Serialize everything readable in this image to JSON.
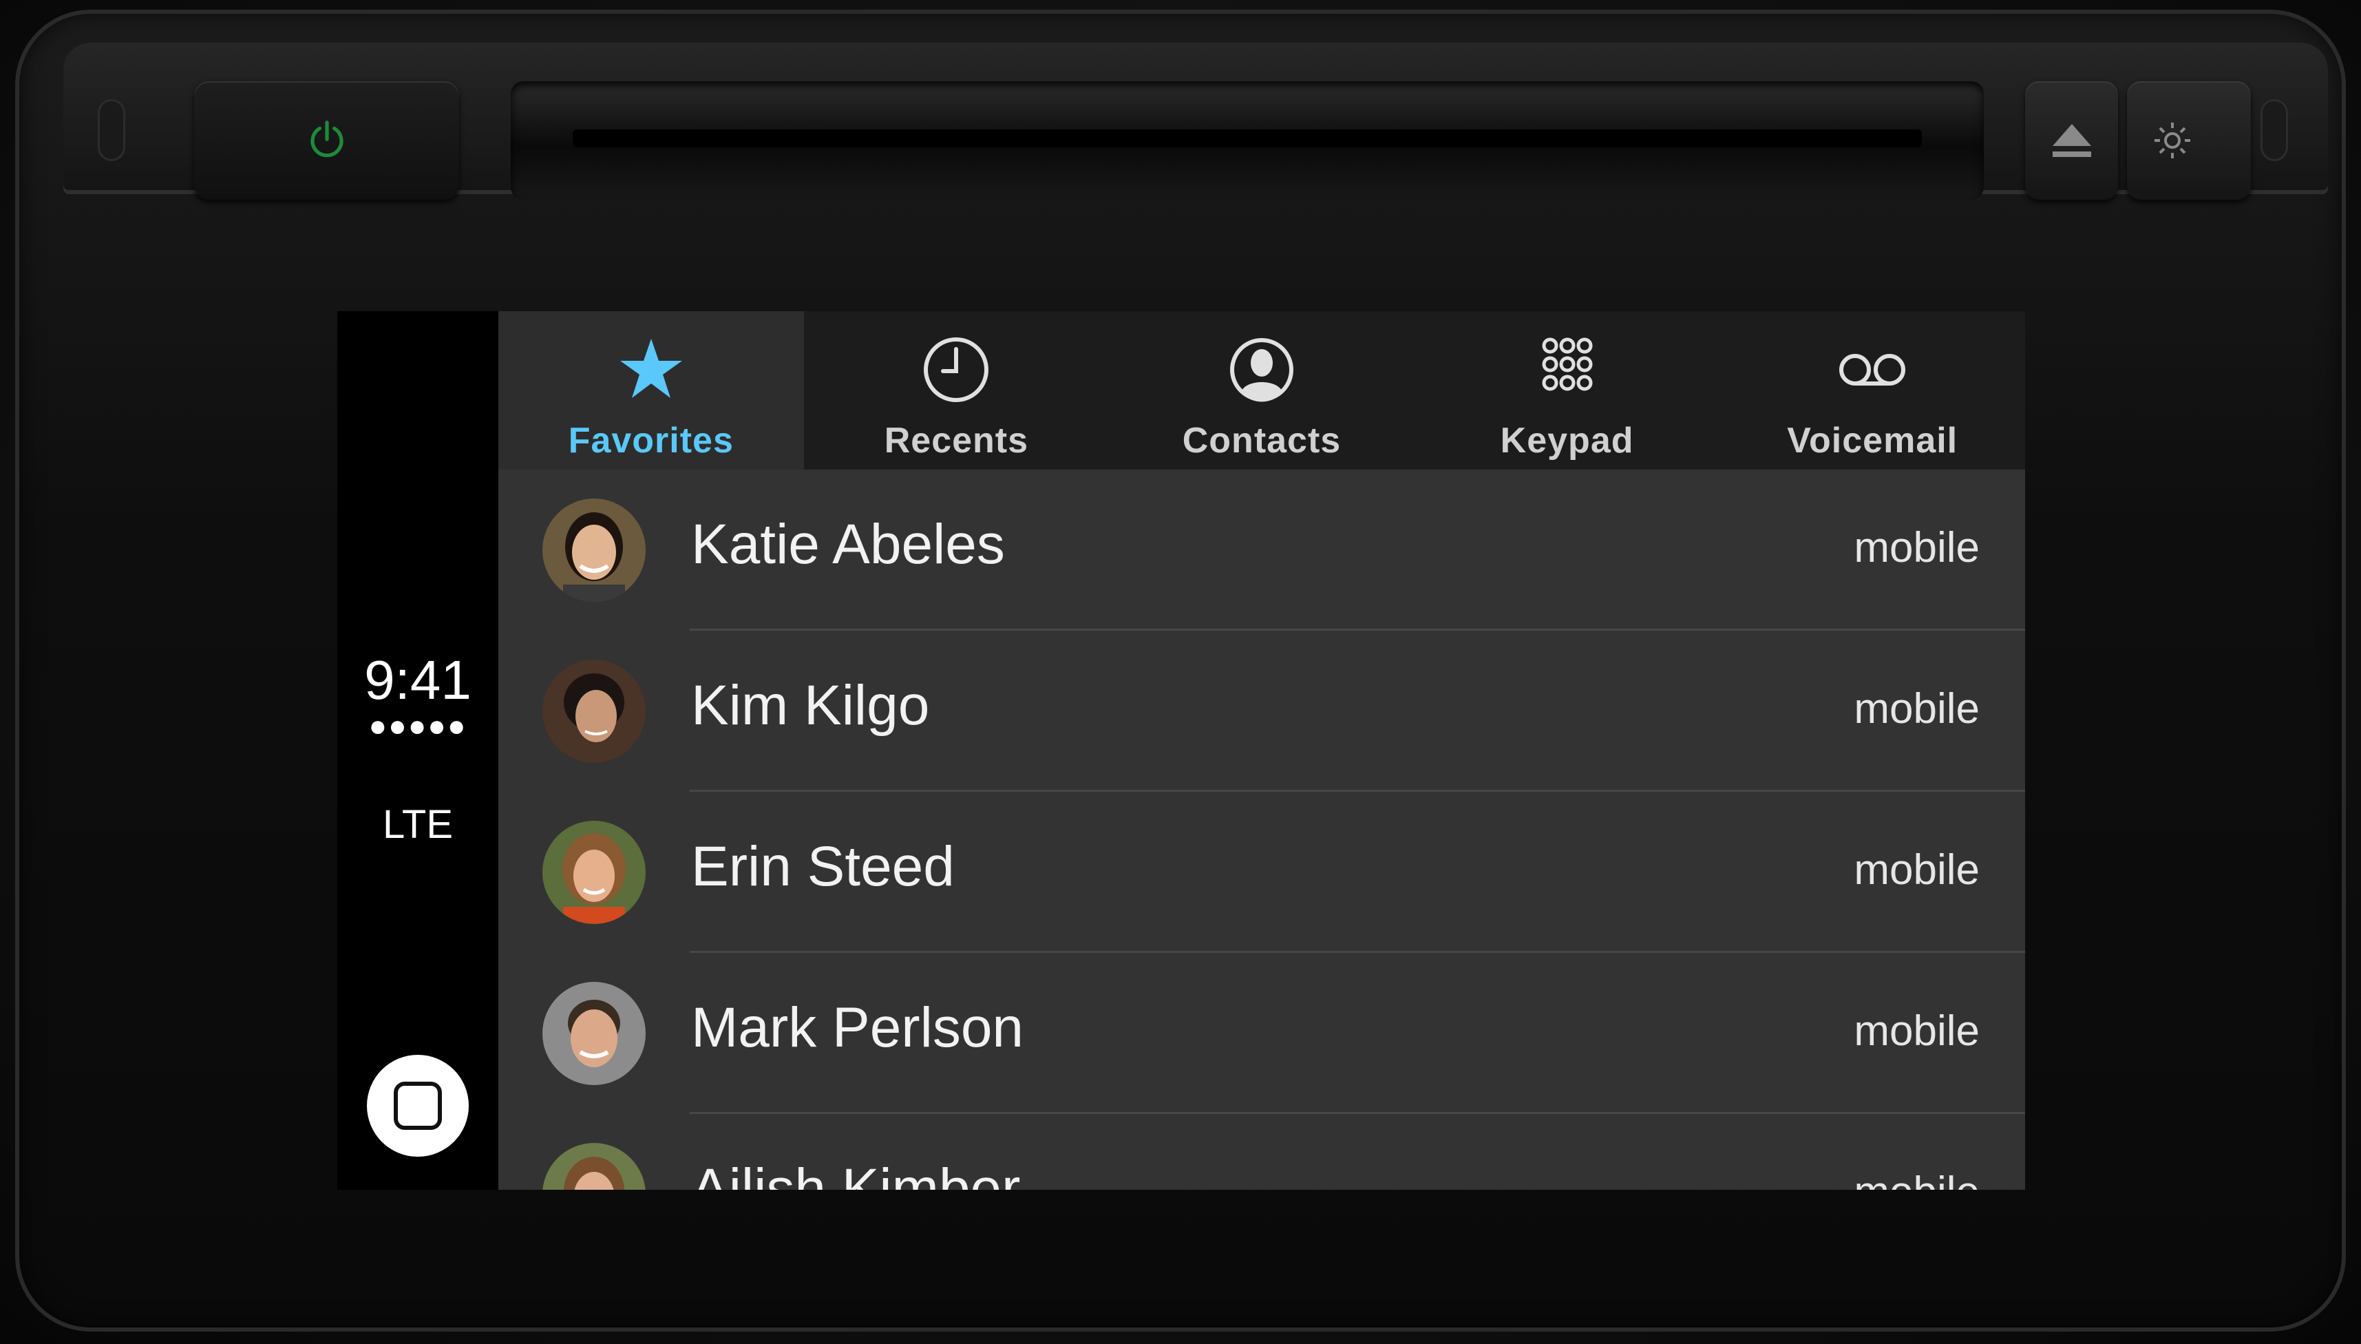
{
  "head_unit": {
    "power_icon": "power-icon",
    "eject_icon": "eject-icon",
    "display_icon": "brightness-moon-icon",
    "accent_color": "#1f8a3a"
  },
  "status": {
    "time": "9:41",
    "signal": "●●●●●",
    "network": "LTE"
  },
  "tabs": [
    {
      "label": "Favorites",
      "icon": "star-icon",
      "selected": true
    },
    {
      "label": "Recents",
      "icon": "clock-icon",
      "selected": false
    },
    {
      "label": "Contacts",
      "icon": "person-icon",
      "selected": false
    },
    {
      "label": "Keypad",
      "icon": "keypad-icon",
      "selected": false
    },
    {
      "label": "Voicemail",
      "icon": "voicemail-icon",
      "selected": false
    }
  ],
  "favorites": [
    {
      "name": "Katie Abeles",
      "kind": "mobile"
    },
    {
      "name": "Kim Kilgo",
      "kind": "mobile"
    },
    {
      "name": "Erin Steed",
      "kind": "mobile"
    },
    {
      "name": "Mark Perlson",
      "kind": "mobile"
    },
    {
      "name": "Ailish Kimber",
      "kind": "mobile"
    }
  ],
  "colors": {
    "selected_tab_text": "#5ac8fa",
    "list_background": "#333333",
    "tabbar_background": "#1c1c1c"
  }
}
